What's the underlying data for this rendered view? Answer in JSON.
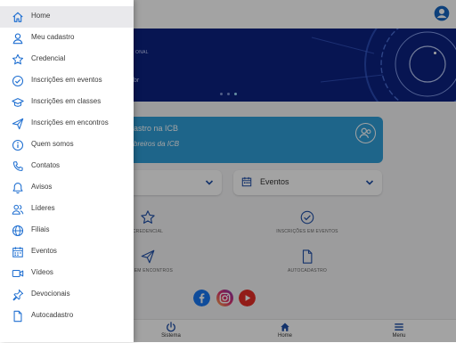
{
  "banner": {
    "line1": "ONAL",
    "line2": "br"
  },
  "card": {
    "title": "astro na ICB",
    "subtitle": "breiros da ICB"
  },
  "selects": [
    {
      "label": ""
    },
    {
      "label": "Eventos"
    }
  ],
  "quick_actions": [
    {
      "label": "CREDENCIAL",
      "icon": "star-icon"
    },
    {
      "label": "INSCRIÇÕES EM EVENTOS",
      "icon": "check-circle-icon"
    },
    {
      "label": "ÕES EM ENCONTROS",
      "icon": "send-icon"
    },
    {
      "label": "AUTOCADASTRO",
      "icon": "document-icon"
    }
  ],
  "social": [
    {
      "name": "facebook-icon",
      "color": "#1877f2"
    },
    {
      "name": "instagram-icon",
      "color": "#d6249f"
    },
    {
      "name": "youtube-icon",
      "color": "#e52d27"
    }
  ],
  "tabs": [
    {
      "label": "Sistema",
      "icon": "power-icon"
    },
    {
      "label": "Home",
      "icon": "home-icon"
    },
    {
      "label": "Menu",
      "icon": "menu-icon"
    }
  ],
  "drawer": {
    "items": [
      {
        "label": "Home",
        "icon": "home-icon"
      },
      {
        "label": "Meu cadastro",
        "icon": "person-icon"
      },
      {
        "label": "Credencial",
        "icon": "star-icon"
      },
      {
        "label": "Inscrições em eventos",
        "icon": "check-circle-icon"
      },
      {
        "label": "Inscrições em classes",
        "icon": "graduation-cap-icon"
      },
      {
        "label": "Inscrições em encontros",
        "icon": "send-icon"
      },
      {
        "label": "Quem somos",
        "icon": "info-icon"
      },
      {
        "label": "Contatos",
        "icon": "phone-icon"
      },
      {
        "label": "Avisos",
        "icon": "bell-icon"
      },
      {
        "label": "Líderes",
        "icon": "people-icon"
      },
      {
        "label": "Filiais",
        "icon": "globe-icon"
      },
      {
        "label": "Eventos",
        "icon": "calendar-icon"
      },
      {
        "label": "Vídeos",
        "icon": "video-icon"
      },
      {
        "label": "Devocionais",
        "icon": "pin-icon"
      },
      {
        "label": "Autocadastro",
        "icon": "document-icon"
      }
    ]
  },
  "colors": {
    "accent": "#2f9ed8",
    "banner": "#0b2180",
    "icon": "#1f6fd1",
    "account": "#1565c0"
  }
}
